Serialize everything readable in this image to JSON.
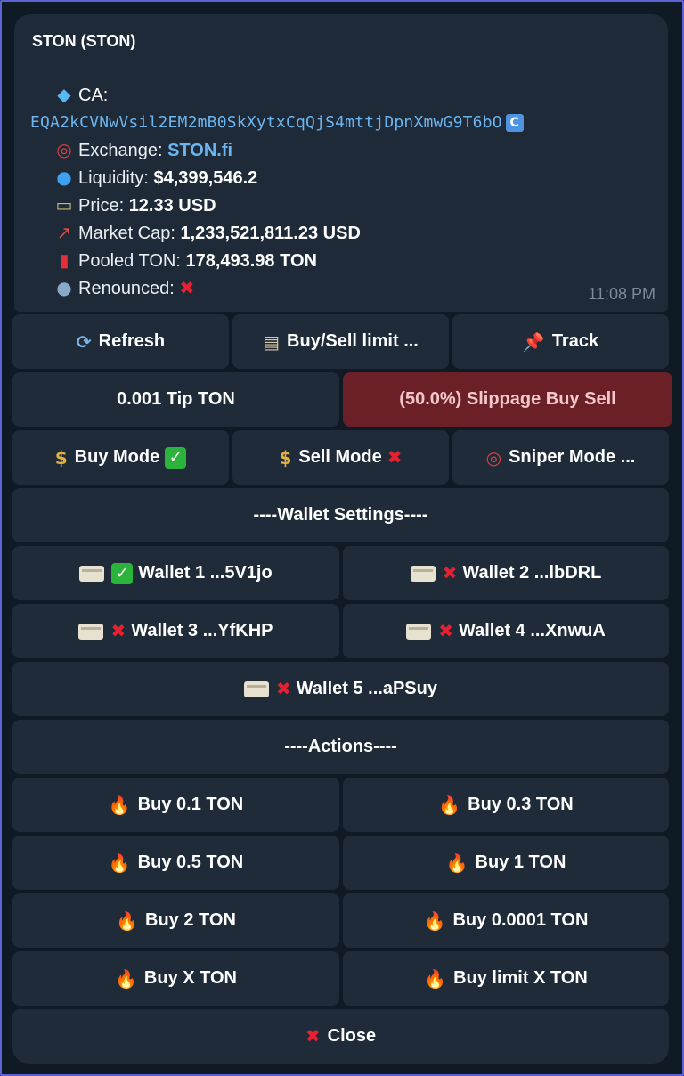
{
  "message": {
    "title": "STON (STON)",
    "ca_label": "CA:",
    "ca_value": "EQA2kCVNwVsil2EM2mB0SkXytxCqQjS4mttjDpnXmwG9T6bO",
    "exchange_label": "Exchange:",
    "exchange_value": "STON.fi",
    "liquidity_label": "Liquidity:",
    "liquidity_value": "$4,399,546.2",
    "price_label": "Price:",
    "price_value": "12.33 USD",
    "market_cap_label": "Market Cap:",
    "market_cap_value": "1,233,521,811.23 USD",
    "pooled_label": "Pooled TON:",
    "pooled_value": "178,493.98 TON",
    "renounced_label": "Renounced:",
    "timestamp": "11:08 PM"
  },
  "keyboard": {
    "refresh": "Refresh",
    "buy_sell_limit": "Buy/Sell limit ...",
    "track": "Track",
    "tip": "0.001 Tip TON",
    "slippage": "(50.0%) Slippage Buy Sell",
    "buy_mode": "Buy Mode",
    "sell_mode": "Sell Mode",
    "sniper_mode": "Sniper Mode ...",
    "wallet_settings": "----Wallet Settings----",
    "wallet1": "Wallet 1 ...5V1jo",
    "wallet2": "Wallet 2 ...lbDRL",
    "wallet3": "Wallet 3 ...YfKHP",
    "wallet4": "Wallet 4 ...XnwuA",
    "wallet5": "Wallet 5 ...aPSuy",
    "actions": "----Actions----",
    "buy_01": "Buy 0.1 TON",
    "buy_03": "Buy 0.3 TON",
    "buy_05": "Buy 0.5 TON",
    "buy_1": "Buy 1 TON",
    "buy_2": "Buy 2 TON",
    "buy_00001": "Buy 0.0001 TON",
    "buy_x": "Buy X TON",
    "buy_limit_x": "Buy limit X TON",
    "close": "Close"
  },
  "icons": {
    "diamond": "diamond-icon",
    "target": "target-icon",
    "droplet": "droplet-icon",
    "money": "money-icon",
    "chart": "chart-icon",
    "extinguisher": "extinguisher-icon",
    "person": "person-icon",
    "refresh": "refresh-icon",
    "clipboard": "clipboard-icon",
    "pin": "pin-icon",
    "moneybag": "money-bag-icon",
    "card": "credit-card-icon",
    "fire": "fire-icon",
    "check": "check-icon",
    "cross": "cross-icon"
  },
  "colors": {
    "accent_link": "#6cb4ee",
    "slippage_bg": "#6b2027",
    "check_green": "#2bb33c",
    "cross_red": "#e8202f"
  }
}
